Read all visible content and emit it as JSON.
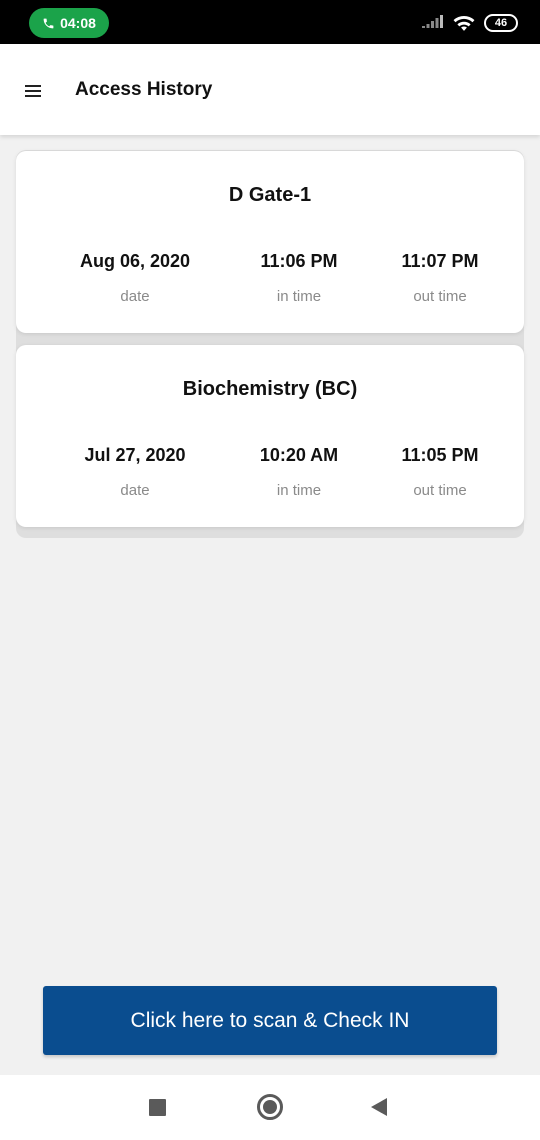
{
  "status_bar": {
    "time": "04:08",
    "battery": "46",
    "icons": [
      "phone-icon",
      "signal-icon",
      "wifi-icon",
      "battery-icon"
    ]
  },
  "app_bar": {
    "title": "Access History",
    "menu_icon": "hamburger-menu-icon"
  },
  "history": [
    {
      "location": "D Gate-1",
      "date": "Aug 06, 2020",
      "in_time": "11:06 PM",
      "out_time": "11:07 PM",
      "date_label": "date",
      "in_label": "in time",
      "out_label": "out time"
    },
    {
      "location": "Biochemistry (BC)",
      "date": "Jul 27, 2020",
      "in_time": "10:20 AM",
      "out_time": "11:05 PM",
      "date_label": "date",
      "in_label": "in time",
      "out_label": "out time"
    }
  ],
  "scan_button": {
    "label": "Click here to scan & Check IN"
  },
  "nav_bar": {
    "icons": [
      "recents-square-icon",
      "home-circle-icon",
      "back-triangle-icon"
    ]
  },
  "colors": {
    "call_pill": "#1ba34a",
    "primary_button": "#0a4d8f",
    "background": "#f1f1f1"
  }
}
